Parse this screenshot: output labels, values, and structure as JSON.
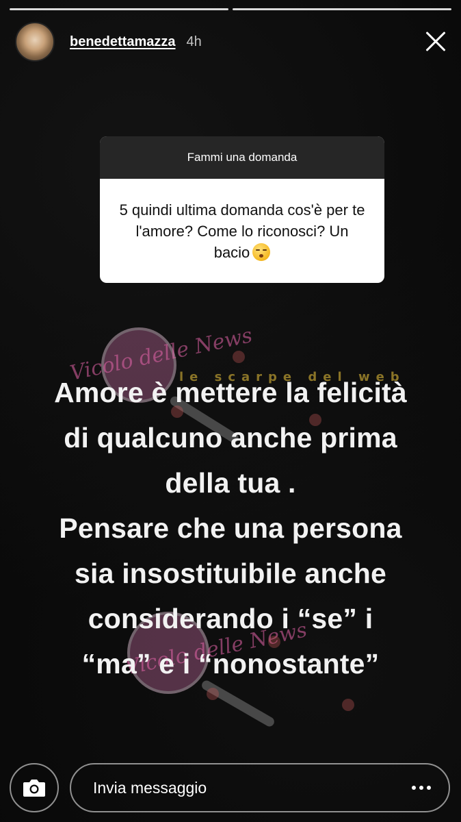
{
  "story": {
    "progress_segments": 2,
    "active_segment": 1
  },
  "header": {
    "username": "benedettamazza",
    "time": "4h",
    "avatar_icon": "profile-avatar",
    "close_icon": "close-icon"
  },
  "question_card": {
    "title": "Fammi una domanda",
    "question": "5 quindi ultima domanda cos'è per te l'amore? Come lo riconosci? Un bacio",
    "emoji": "kissing-face-emoji"
  },
  "answer": {
    "lines": [
      "Amore è mettere la felicità",
      "di qualcuno anche prima",
      "della tua .",
      "Pensare che una persona",
      "sia insostituibile anche",
      "considerando i “se” i",
      "“ma” e i “nonostante”"
    ]
  },
  "watermarks": {
    "mark_1": "Vicolo delle News",
    "mark_2": "le scarpe del web"
  },
  "footer": {
    "camera_icon": "camera-icon",
    "message_placeholder": "Invia messaggio",
    "more_icon": "more-options-icon"
  },
  "colors": {
    "background": "#0a0a0a",
    "card_header": "#262626",
    "card_body": "#ffffff",
    "text": "#ffffff"
  }
}
